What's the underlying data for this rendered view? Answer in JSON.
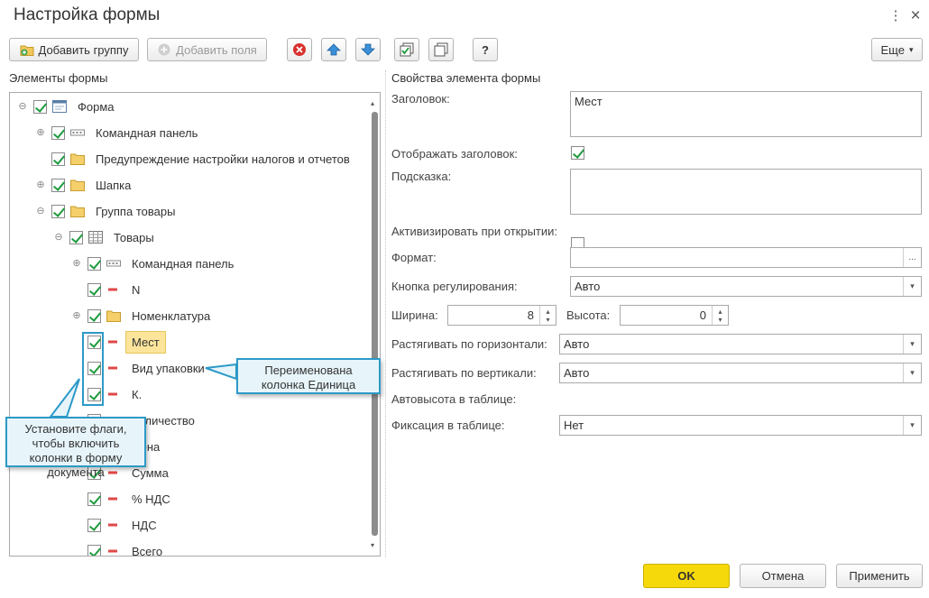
{
  "window": {
    "title": "Настройка формы",
    "menu_glyph": "⋮",
    "close_glyph": "×"
  },
  "toolbar": {
    "add_group": "Добавить группу",
    "add_fields": "Добавить поля",
    "help": "?",
    "more": "Еще",
    "more_arrow": "▾"
  },
  "left": {
    "header": "Элементы формы"
  },
  "tree": {
    "nodes": [
      {
        "label": "Форма",
        "toggle": "⊖",
        "icon": "form-icon"
      },
      {
        "label": "Командная панель",
        "toggle": "⊕",
        "icon": "command-panel-icon"
      },
      {
        "label": "Предупреждение настройки налогов и отчетов",
        "toggle": "",
        "icon": "folder-icon"
      },
      {
        "label": "Шапка",
        "toggle": "⊕",
        "icon": "folder-icon"
      },
      {
        "label": "Группа товары",
        "toggle": "⊖",
        "icon": "folder-icon"
      },
      {
        "label": "Товары",
        "toggle": "⊖",
        "icon": "table-icon"
      },
      {
        "label": "Командная панель",
        "toggle": "⊕",
        "icon": "command-panel-icon"
      },
      {
        "label": "N",
        "toggle": "",
        "icon": "field-icon"
      },
      {
        "label": "Номенклатура",
        "toggle": "⊕",
        "icon": "folder-icon"
      },
      {
        "label": "Мест",
        "toggle": "",
        "icon": "field-icon"
      },
      {
        "label": "Вид упаковки",
        "toggle": "",
        "icon": "field-icon"
      },
      {
        "label": "К.",
        "toggle": "",
        "icon": "field-icon"
      },
      {
        "label": "Количество",
        "toggle": "",
        "icon": "field-icon"
      },
      {
        "label": "Цена",
        "toggle": "",
        "icon": "field-icon"
      },
      {
        "label": "Сумма",
        "toggle": "",
        "icon": "field-icon"
      },
      {
        "label": "% НДС",
        "toggle": "",
        "icon": "field-icon"
      },
      {
        "label": "НДС",
        "toggle": "",
        "icon": "field-icon"
      },
      {
        "label": "Всего",
        "toggle": "",
        "icon": "field-icon"
      }
    ]
  },
  "props": {
    "header": "Свойства элемента формы",
    "title_label": "Заголовок:",
    "title_value": "Мест",
    "show_title_label": "Отображать заголовок:",
    "show_title_checked": true,
    "hint_label": "Подсказка:",
    "hint_value": "",
    "activate_label": "Активизировать при открытии:",
    "activate_checked": false,
    "format_label": "Формат:",
    "format_value": "",
    "format_btn": "...",
    "adjust_btn_label": "Кнопка регулирования:",
    "adjust_btn_value": "Авто",
    "width_label": "Ширина:",
    "width_value": "8",
    "height_label": "Высота:",
    "height_value": "0",
    "stretch_h_label": "Растягивать по горизонтали:",
    "stretch_h_value": "Авто",
    "stretch_v_label": "Растягивать по вертикали:",
    "stretch_v_value": "Авто",
    "autoheight_label": "Автовысота в таблице:",
    "autoheight_checked": false,
    "fix_label": "Фиксация в таблице:",
    "fix_value": "Нет",
    "dropdown_arrow": "▾",
    "spin_up": "▴",
    "spin_down": "▾"
  },
  "callouts": {
    "renamed": "Переименована колонка Единица",
    "flags": "Установите флаги, чтобы включить колонки в форму документа"
  },
  "footer": {
    "ok": "OK",
    "cancel": "Отмена",
    "apply": "Применить"
  },
  "colors": {
    "ok_button": "#f5d90a",
    "callout_border": "#2c9ac8",
    "check": "#1e9b3e",
    "selected_bg": "#fce59a"
  }
}
